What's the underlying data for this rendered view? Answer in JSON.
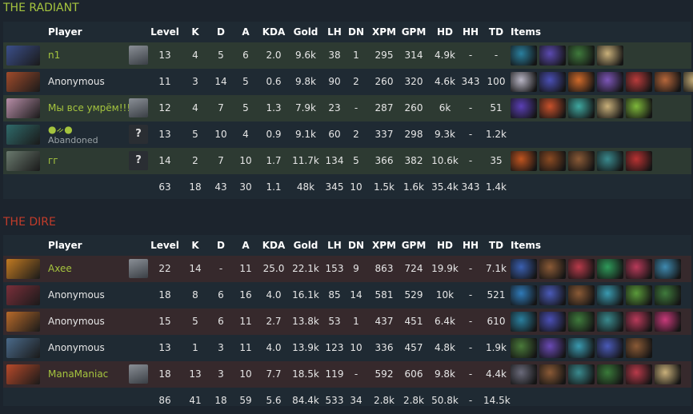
{
  "radiant": {
    "title": "THE RADIANT",
    "headers": [
      "Player",
      "Level",
      "K",
      "D",
      "A",
      "KDA",
      "Gold",
      "LH",
      "DN",
      "XPM",
      "GPM",
      "HD",
      "HH",
      "TD",
      "Items"
    ],
    "rows": [
      {
        "name": "n1",
        "status": "",
        "level": "13",
        "k": "4",
        "d": "5",
        "a": "6",
        "kda": "2.0",
        "gold": "9.6k",
        "lh": "38",
        "dn": "1",
        "xpm": "295",
        "gpm": "314",
        "hd": "4.9k",
        "hh": "-",
        "td": "-",
        "hero_color": "#3b4f8a",
        "avatar": "image",
        "items": [
          "#2a7f9e",
          "#5b4ab0",
          "#3f7a3c",
          "#c9b07a"
        ]
      },
      {
        "name": "Anonymous",
        "status": "",
        "level": "11",
        "k": "3",
        "d": "14",
        "a": "5",
        "kda": "0.6",
        "gold": "9.8k",
        "lh": "90",
        "dn": "2",
        "xpm": "260",
        "gpm": "320",
        "hd": "4.6k",
        "hh": "343",
        "td": "100",
        "hero_color": "#a04b2b",
        "avatar": "none",
        "items": [
          "#b8b5c4",
          "#4a4fb5",
          "#d06a2a",
          "#7d56b8",
          "#b83b3b",
          "#b6673b",
          "#c9b07a"
        ]
      },
      {
        "name": "Мы все умрём!!!",
        "status": "",
        "level": "12",
        "k": "4",
        "d": "7",
        "a": "5",
        "kda": "1.3",
        "gold": "7.9k",
        "lh": "23",
        "dn": "-",
        "xpm": "287",
        "gpm": "260",
        "hd": "6k",
        "hh": "-",
        "td": "51",
        "hero_color": "#b88ea8",
        "avatar": "image",
        "items": [
          "#5a3fb5",
          "#c8512b",
          "#3fa8a0",
          "#c9b07a",
          "#7eb83a"
        ]
      },
      {
        "name": "●ᨀ●",
        "status": "Abandoned",
        "level": "13",
        "k": "5",
        "d": "10",
        "a": "4",
        "kda": "0.9",
        "gold": "9.1k",
        "lh": "60",
        "dn": "2",
        "xpm": "337",
        "gpm": "298",
        "hd": "9.3k",
        "hh": "-",
        "td": "1.2k",
        "hero_color": "#2f6a6a",
        "avatar": "?",
        "items": []
      },
      {
        "name": "гг",
        "status": "",
        "level": "14",
        "k": "2",
        "d": "7",
        "a": "10",
        "kda": "1.7",
        "gold": "11.7k",
        "lh": "134",
        "dn": "5",
        "xpm": "366",
        "gpm": "382",
        "hd": "10.6k",
        "hh": "-",
        "td": "35",
        "hero_color": "#6a7a6e",
        "avatar": "?",
        "items": [
          "#c0541f",
          "#8a4a22",
          "#8a5a36",
          "#3a8a8e",
          "#b83232"
        ]
      }
    ],
    "totals": {
      "level": "63",
      "k": "18",
      "d": "43",
      "a": "30",
      "kda": "1.1",
      "gold": "48k",
      "lh": "345",
      "dn": "10",
      "xpm": "1.5k",
      "gpm": "1.6k",
      "hd": "35.4k",
      "hh": "343",
      "td": "1.4k"
    }
  },
  "dire": {
    "title": "THE DIRE",
    "headers": [
      "Player",
      "Level",
      "K",
      "D",
      "A",
      "KDA",
      "Gold",
      "LH",
      "DN",
      "XPM",
      "GPM",
      "HD",
      "HH",
      "TD",
      "Items"
    ],
    "rows": [
      {
        "name": "Axee",
        "status": "",
        "level": "22",
        "k": "14",
        "d": "-",
        "a": "11",
        "kda": "25.0",
        "gold": "22.1k",
        "lh": "153",
        "dn": "9",
        "xpm": "863",
        "gpm": "724",
        "hd": "19.9k",
        "hh": "-",
        "td": "7.1k",
        "hero_color": "#c27a22",
        "avatar": "image",
        "items": [
          "#3a5fb0",
          "#8a5a36",
          "#b83a4a",
          "#2f9a5a",
          "#b83a5a",
          "#3f8ab0"
        ]
      },
      {
        "name": "Anonymous",
        "status": "",
        "level": "18",
        "k": "8",
        "d": "6",
        "a": "16",
        "kda": "4.0",
        "gold": "16.1k",
        "lh": "85",
        "dn": "14",
        "xpm": "581",
        "gpm": "529",
        "hd": "10k",
        "hh": "-",
        "td": "521",
        "hero_color": "#7a2f3a",
        "avatar": "none",
        "items": [
          "#2f7ab8",
          "#4a5ab8",
          "#8a5a36",
          "#3a9ab0",
          "#5a9a3a",
          "#3f7a3c"
        ]
      },
      {
        "name": "Anonymous",
        "status": "",
        "level": "15",
        "k": "5",
        "d": "6",
        "a": "11",
        "kda": "2.7",
        "gold": "13.8k",
        "lh": "53",
        "dn": "1",
        "xpm": "437",
        "gpm": "451",
        "hd": "6.4k",
        "hh": "-",
        "td": "610",
        "hero_color": "#b86a2a",
        "avatar": "none",
        "items": [
          "#2a7f9e",
          "#4a4fb5",
          "#3f7a3c",
          "#3a8a8e",
          "#b83a5a",
          "#c83a7a"
        ]
      },
      {
        "name": "Anonymous",
        "status": "",
        "level": "13",
        "k": "1",
        "d": "3",
        "a": "11",
        "kda": "4.0",
        "gold": "13.9k",
        "lh": "123",
        "dn": "10",
        "xpm": "336",
        "gpm": "457",
        "hd": "4.8k",
        "hh": "-",
        "td": "1.9k",
        "hero_color": "#4a6a8a",
        "avatar": "none",
        "items": [
          "#4a7a3a",
          "#6a4ab5",
          "#3a9ab0",
          "#4a5ab8",
          "#8a5a36"
        ]
      },
      {
        "name": "ManaManiac",
        "status": "",
        "level": "18",
        "k": "13",
        "d": "3",
        "a": "10",
        "kda": "7.7",
        "gold": "18.5k",
        "lh": "119",
        "dn": "-",
        "xpm": "592",
        "gpm": "606",
        "hd": "9.8k",
        "hh": "-",
        "td": "4.4k",
        "hero_color": "#b84a2a",
        "avatar": "image",
        "items": [
          "#6a6a7a",
          "#8a5a36",
          "#3a8a8e",
          "#3a7a3a",
          "#b83a4a",
          "#c9b07a"
        ]
      }
    ],
    "totals": {
      "level": "86",
      "k": "41",
      "d": "18",
      "a": "59",
      "kda": "5.6",
      "gold": "84.4k",
      "lh": "533",
      "dn": "34",
      "xpm": "2.8k",
      "gpm": "2.8k",
      "hd": "50.8k",
      "hh": "-",
      "td": "14.5k"
    }
  }
}
